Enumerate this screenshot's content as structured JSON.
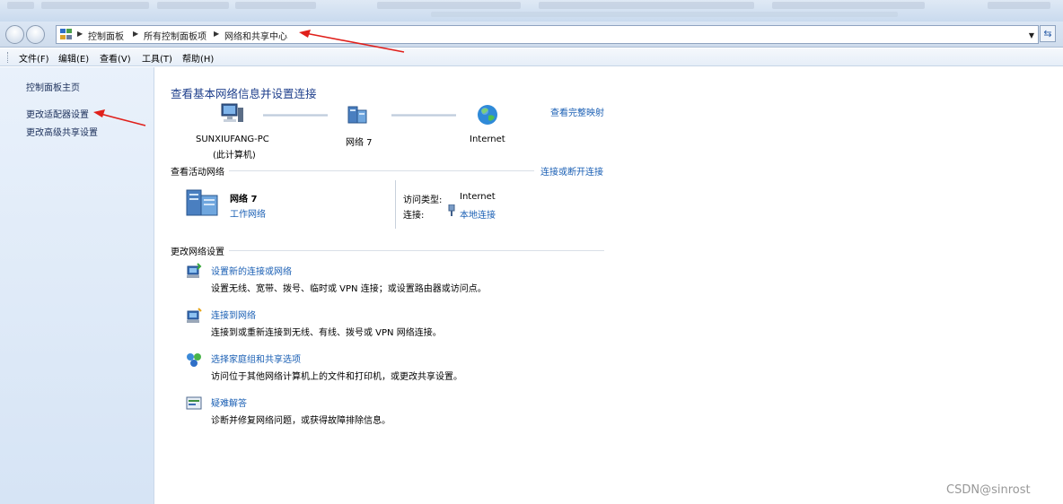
{
  "address_bar": {
    "crumbs": [
      "控制面板",
      "所有控制面板项",
      "网络和共享中心"
    ]
  },
  "menu": [
    "文件(F)",
    "编辑(E)",
    "查看(V)",
    "工具(T)",
    "帮助(H)"
  ],
  "sidebar": {
    "items": [
      {
        "label": "控制面板主页"
      },
      {
        "label": "更改适配器设置"
      },
      {
        "label": "更改高级共享设置"
      }
    ]
  },
  "main": {
    "title": "查看基本网络信息并设置连接",
    "full_map_link": "查看完整映射",
    "map": {
      "computer_name": "SUNXIUFANG-PC",
      "computer_sub": "(此计算机)",
      "network_name": "网络  7",
      "internet": "Internet"
    },
    "active": {
      "section_title": "查看活动网络",
      "connect_link": "连接或断开连接",
      "network_name": "网络  7",
      "network_type": "工作网络",
      "access_type_label": "访问类型:",
      "access_type_value": "Internet",
      "connection_label": "连接:",
      "connection_value": "本地连接"
    },
    "change": {
      "section_title": "更改网络设置",
      "tasks": [
        {
          "link": "设置新的连接或网络",
          "desc": "设置无线、宽带、拨号、临时或 VPN 连接；或设置路由器或访问点。"
        },
        {
          "link": "连接到网络",
          "desc": "连接到或重新连接到无线、有线、拨号或 VPN 网络连接。"
        },
        {
          "link": "选择家庭组和共享选项",
          "desc": "访问位于其他网络计算机上的文件和打印机，或更改共享设置。"
        },
        {
          "link": "疑难解答",
          "desc": "诊断并修复网络问题，或获得故障排除信息。"
        }
      ]
    }
  },
  "watermark": "CSDN@sinrost",
  "colors": {
    "link": "#1a5fb4",
    "title": "#1e3f8c",
    "arrow": "#e0201b"
  }
}
